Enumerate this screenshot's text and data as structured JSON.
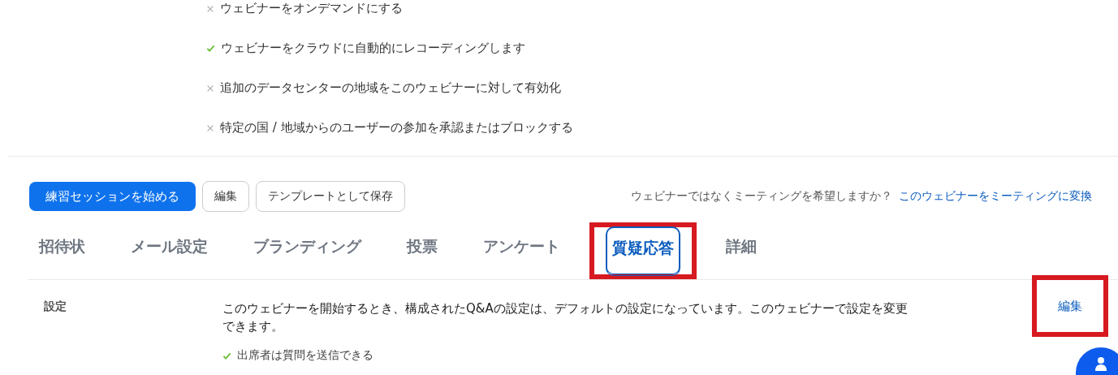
{
  "options": [
    {
      "label": "ウェビナーをオンデマンドにする",
      "checked": false
    },
    {
      "label": "ウェビナーをクラウドに自動的にレコーディングします",
      "checked": true
    },
    {
      "label": "追加のデータセンターの地域をこのウェビナーに対して有効化",
      "checked": false
    },
    {
      "label": "特定の国 / 地域からのユーザーの参加を承認またはブロックする",
      "checked": false
    }
  ],
  "actions": {
    "start_practice": "練習セッションを始める",
    "edit": "編集",
    "save_template": "テンプレートとして保存",
    "convert_prompt": "ウェビナーではなくミーティングを希望しますか？",
    "convert_link": "このウェビナーをミーティングに変換"
  },
  "tabs": [
    {
      "label": "招待状",
      "selected": false,
      "highlighted": false
    },
    {
      "label": "メール設定",
      "selected": false,
      "highlighted": false
    },
    {
      "label": "ブランディング",
      "selected": false,
      "highlighted": false
    },
    {
      "label": "投票",
      "selected": false,
      "highlighted": false
    },
    {
      "label": "アンケート",
      "selected": false,
      "highlighted": false
    },
    {
      "label": "質疑応答",
      "selected": true,
      "highlighted": true
    },
    {
      "label": "詳細",
      "selected": false,
      "highlighted": false
    }
  ],
  "qa_settings": {
    "label": "設定",
    "description": "このウェビナーを開始するとき、構成されたQ&Aの設定は、デフォルトの設定になっています。このウェビナーで設定を変更できます。",
    "edit": "編集",
    "edit_highlighted": true,
    "options": [
      {
        "label": "出席者は質問を送信できる",
        "checked": true
      }
    ]
  }
}
